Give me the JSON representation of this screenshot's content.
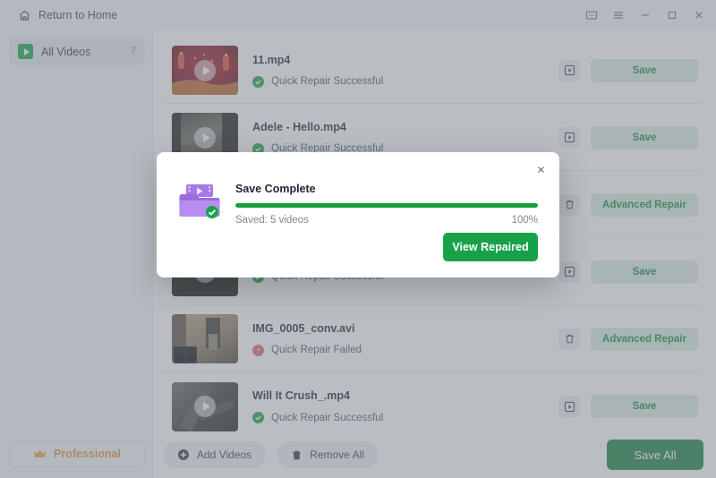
{
  "titlebar": {
    "home_label": "Return to Home",
    "icons": [
      "home-icon",
      "feedback-icon",
      "menu-icon",
      "minimize-icon",
      "maximize-icon",
      "close-icon"
    ]
  },
  "sidebar": {
    "item_label": "All Videos",
    "item_count": "7",
    "pro_label": "Professional"
  },
  "rows": [
    {
      "filename": "11.mp4",
      "status": "Quick Repair Successful",
      "state": "ok",
      "action_label": "Save",
      "icon": "play-icon",
      "thumb": "festive-red"
    },
    {
      "filename": "Adele - Hello.mp4",
      "status": "Quick Repair Successful",
      "state": "ok",
      "action_label": "Save",
      "icon": "play-icon",
      "thumb": "dim-room"
    },
    {
      "filename": "",
      "status": "",
      "state": "ok",
      "action_label": "Advanced Repair",
      "icon": "trash-icon",
      "thumb": "hidden"
    },
    {
      "filename": "",
      "status": "Quick Repair Successful",
      "state": "ok",
      "action_label": "Save",
      "icon": "play-icon",
      "thumb": "dark-scene"
    },
    {
      "filename": "IMG_0005_conv.avi",
      "status": "Quick Repair Failed",
      "state": "fail",
      "action_label": "Advanced Repair",
      "icon": "trash-icon",
      "thumb": "room-gear"
    },
    {
      "filename": "Will It Crush_.mp4",
      "status": "Quick Repair Successful",
      "state": "ok",
      "action_label": "Save",
      "icon": "play-icon",
      "thumb": "gray-crush"
    }
  ],
  "footer": {
    "add_label": "Add Videos",
    "remove_label": "Remove All",
    "save_all_label": "Save All"
  },
  "modal": {
    "title": "Save Complete",
    "saved_text": "Saved: 5 videos",
    "percent": "100%",
    "progress_value": 100,
    "button_label": "View Repaired"
  },
  "colors": {
    "green": "#17a24a",
    "green_dark": "#17803d",
    "green_soft_bg": "#d9ecdf",
    "green_soft_text": "#148a43",
    "fail_red": "#e4626f",
    "gold": "#d89a33"
  }
}
